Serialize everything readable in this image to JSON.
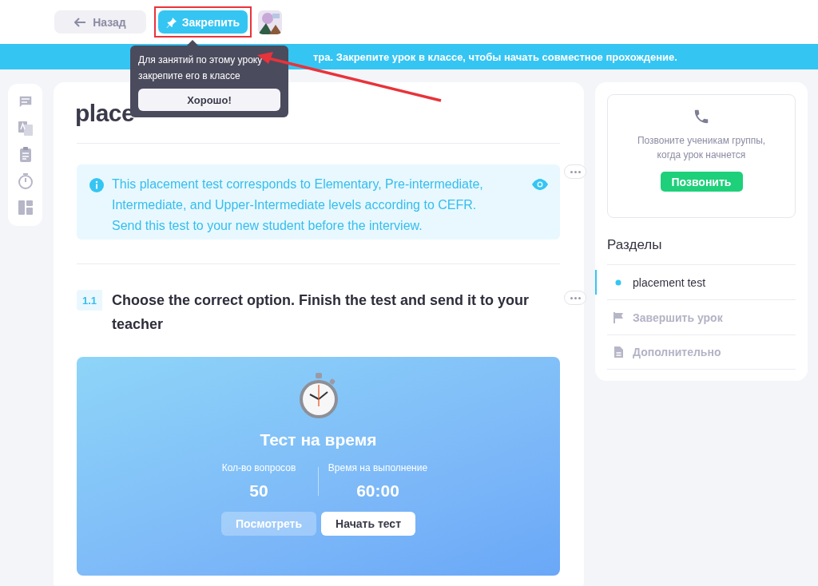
{
  "toolbar": {
    "back_button": "Назад",
    "pin_button": "Закрепить"
  },
  "tooltip": {
    "text": "Для занятий по этому уроку закрепите его в классе",
    "button": "Хорошо!"
  },
  "banner": {
    "text": "тра. Закрепите урок в классе, чтобы начать совместное прохождение."
  },
  "lesson": {
    "title": "place",
    "info": "This placement test corresponds to Elementary, Pre-intermediate, Intermediate, and Upper-Intermediate levels according to CEFR. Send this test to your new student before the interview.",
    "question": {
      "number": "1.1",
      "text": "Choose the correct option. Finish the test and send it to your teacher"
    },
    "timed_test": {
      "title": "Тест на время",
      "stats": [
        {
          "label": "Кол-во вопросов",
          "value": "50"
        },
        {
          "label": "Время на выполнение",
          "value": "60:00"
        }
      ],
      "buttons": [
        {
          "label": "Посмотреть",
          "kind": "secondary"
        },
        {
          "label": "Начать тест",
          "kind": "primary"
        }
      ]
    }
  },
  "call_panel": {
    "text": "Позвоните ученикам группы, когда урок начнется",
    "button": "Позвонить"
  },
  "sections": {
    "title": "Разделы",
    "items": [
      {
        "label": "placement test",
        "selected": true,
        "kind": "lesson"
      },
      {
        "label": "Завершить урок",
        "selected": false,
        "kind": "finish"
      },
      {
        "label": "Дополнительно",
        "selected": false,
        "kind": "extra"
      }
    ]
  }
}
